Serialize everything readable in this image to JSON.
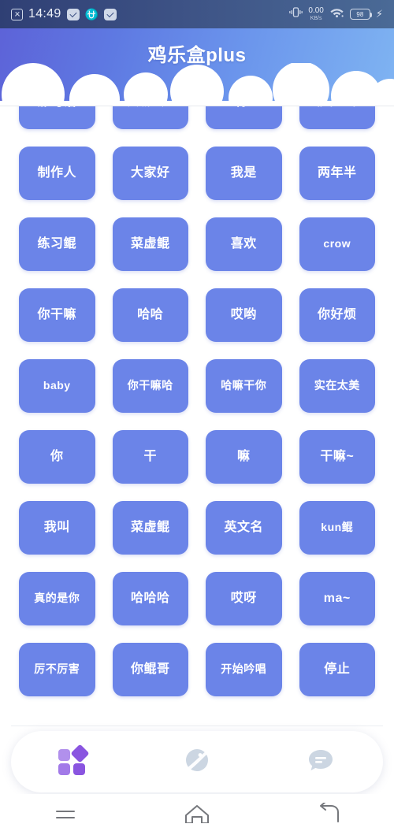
{
  "status_bar": {
    "time": "14:49",
    "left_icons": [
      "app-badge-icon",
      "scissors-icon",
      "usb-icon",
      "mail-icon"
    ],
    "network_speed": "0.00",
    "network_unit": "KB/s",
    "wifi_icon": "wifi-icon",
    "vibrate_icon": "vibrate-icon",
    "battery_level": "98",
    "charging_icon": "lightning-bolt-icon"
  },
  "header": {
    "title": "鸡乐盒plus",
    "gradient_from": "#5d63d8",
    "gradient_to": "#7fb4f2",
    "cloud_color": "#ffffff"
  },
  "grid": {
    "button_color": "#6b84e8",
    "text_color": "#ffffff",
    "columns": 4,
    "buttons": [
      {
        "label": "那句话",
        "clipped": true
      },
      {
        "label": "大喊一声",
        "clipped": true
      },
      {
        "label": "啊~",
        "clipped": true
      },
      {
        "label": "非常正常",
        "clipped": true
      },
      {
        "label": "制作人"
      },
      {
        "label": "大家好"
      },
      {
        "label": "我是"
      },
      {
        "label": "两年半"
      },
      {
        "label": "练习鲲"
      },
      {
        "label": "菜虚鲲"
      },
      {
        "label": "喜欢"
      },
      {
        "label": "crow"
      },
      {
        "label": "你干嘛"
      },
      {
        "label": "哈哈"
      },
      {
        "label": "哎哟"
      },
      {
        "label": "你好烦"
      },
      {
        "label": "baby"
      },
      {
        "label": "你干嘛哈"
      },
      {
        "label": "哈嘛干你"
      },
      {
        "label": "实在太美"
      },
      {
        "label": "你"
      },
      {
        "label": "干"
      },
      {
        "label": "嘛"
      },
      {
        "label": "干嘛~"
      },
      {
        "label": "我叫"
      },
      {
        "label": "菜虚鲲"
      },
      {
        "label": "英文名"
      },
      {
        "label": "kun鲲"
      },
      {
        "label": "真的是你"
      },
      {
        "label": "哈哈哈"
      },
      {
        "label": "哎呀"
      },
      {
        "label": "ma~"
      },
      {
        "label": "厉不厉害"
      },
      {
        "label": "你鲲哥"
      },
      {
        "label": "开始吟唱"
      },
      {
        "label": "停止"
      }
    ]
  },
  "bottom_nav": {
    "active_index": 0,
    "active_color": "#8a55e0",
    "inactive_color": "#ccd4e0",
    "items": [
      {
        "icon": "grid-apps-icon",
        "active": true
      },
      {
        "icon": "planet-icon",
        "active": false
      },
      {
        "icon": "chat-bubble-icon",
        "active": false
      }
    ]
  },
  "android_nav": {
    "items": [
      {
        "icon": "recents-icon"
      },
      {
        "icon": "home-icon"
      },
      {
        "icon": "back-icon"
      }
    ],
    "color": "#75777c"
  }
}
